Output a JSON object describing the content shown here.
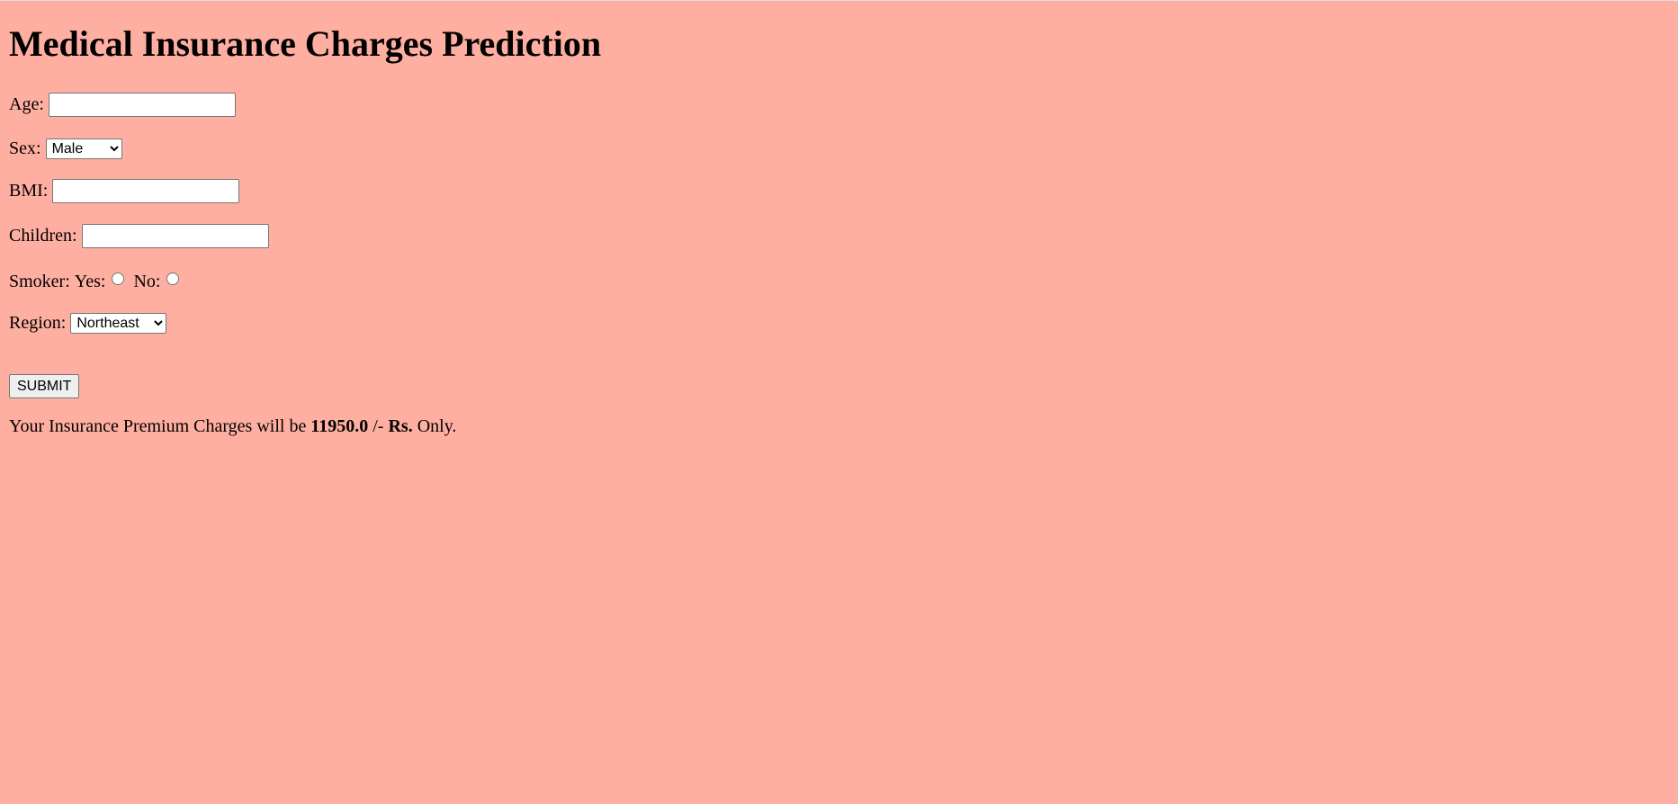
{
  "page": {
    "title": "Medical Insurance Charges Prediction",
    "background_color": "#ffafa1"
  },
  "form": {
    "age": {
      "label": "Age:",
      "value": ""
    },
    "sex": {
      "label": "Sex:",
      "selected": "Male"
    },
    "bmi": {
      "label": "BMI:",
      "value": ""
    },
    "children": {
      "label": "Children:",
      "value": ""
    },
    "smoker": {
      "label": "Smoker:",
      "yes_label": "Yes:",
      "no_label": "No:"
    },
    "region": {
      "label": "Region:",
      "selected": "Northeast"
    },
    "submit_label": "SUBMIT"
  },
  "result": {
    "prefix": "Your Insurance Premium Charges will be",
    "amount": "11950.0",
    "separator": "/-",
    "currency": "Rs.",
    "suffix": "Only."
  }
}
